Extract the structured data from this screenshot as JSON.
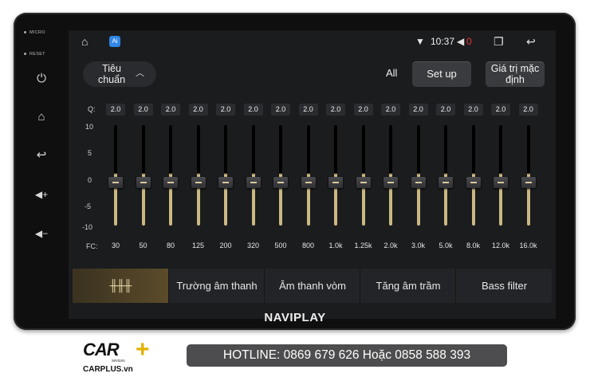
{
  "side": {
    "micro": "MICRO",
    "reset": "RESET"
  },
  "status": {
    "time": "10:37",
    "volume": "0",
    "app_badge": "Ai"
  },
  "preset": {
    "label": "Tiêu chuẩn"
  },
  "header": {
    "all_label": "All",
    "setup_label": "Set up",
    "default_label": "Giá trị mặc định"
  },
  "eq": {
    "q_label": "Q:",
    "fc_label": "FC:",
    "scale": [
      "10",
      "5",
      "0",
      "-5",
      "-10"
    ],
    "q_values": [
      "2.0",
      "2.0",
      "2.0",
      "2.0",
      "2.0",
      "2.0",
      "2.0",
      "2.0",
      "2.0",
      "2.0",
      "2.0",
      "2.0",
      "2.0",
      "2.0",
      "2.0",
      "2.0"
    ],
    "frequencies": [
      "30",
      "50",
      "80",
      "125",
      "200",
      "320",
      "500",
      "800",
      "1.0k",
      "1.25k",
      "2.0k",
      "3.0k",
      "5.0k",
      "8.0k",
      "12.0k",
      "16.0k"
    ],
    "gains": [
      0,
      0,
      0,
      0,
      0,
      0,
      0,
      0,
      0,
      0,
      0,
      0,
      0,
      0,
      0,
      0
    ]
  },
  "tabs": [
    {
      "label": ""
    },
    {
      "label": "Trường âm thanh"
    },
    {
      "label": "Âm thanh vòm"
    },
    {
      "label": "Tăng âm trầm"
    },
    {
      "label": "Bass filter"
    }
  ],
  "brand": "NAVIPLAY",
  "logo": {
    "car": "CAR",
    "services": "sevices",
    "site": "CARPLUS.vn"
  },
  "hotline": "HOTLINE: 0869 679 626 Hoặc 0858 588 393"
}
